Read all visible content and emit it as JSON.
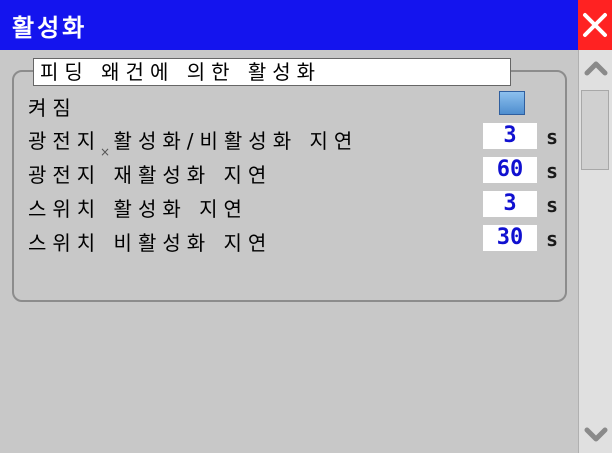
{
  "window": {
    "title": "활성화"
  },
  "group": {
    "title": "피딩 왜건에 의한 활성화"
  },
  "enabled": {
    "label": "켜짐",
    "checked": true
  },
  "rows": [
    {
      "label": "광전지 활성화/비활성화 지연",
      "value": "3",
      "unit": "s"
    },
    {
      "label": "광전지 재활성화 지연",
      "value": "60",
      "unit": "s"
    },
    {
      "label": "스위치 활성화 지연",
      "value": "3",
      "unit": "s"
    },
    {
      "label": "스위치 비활성화 지연",
      "value": "30",
      "unit": "s"
    }
  ],
  "icons": {
    "close": "close-icon",
    "scroll_up": "chevron-up-icon",
    "scroll_down": "chevron-down-icon"
  },
  "colors": {
    "titlebar": "#1414ee",
    "close": "#ff2222",
    "value_text": "#1010d0",
    "background": "#c8c8c8"
  }
}
